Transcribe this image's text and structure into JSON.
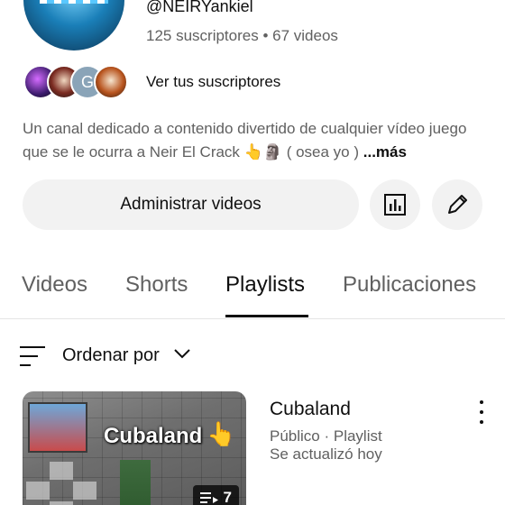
{
  "channel": {
    "handle": "@NEIRYankiel",
    "stats": "125 suscriptores • 67 videos",
    "subscribers_link": "Ver tus suscriptores",
    "subscriber_initial": "G",
    "description": "Un canal dedicado a contenido divertido de cualquier vídeo juego que se le ocurra a Neir El Crack 👆🗿 ( osea yo ) ",
    "more_label": "...más"
  },
  "actions": {
    "manage_label": "Administrar videos",
    "stats_icon": "analytics-icon",
    "edit_icon": "pencil-icon"
  },
  "tabs": [
    {
      "label": "Videos",
      "active": false
    },
    {
      "label": "Shorts",
      "active": false
    },
    {
      "label": "Playlists",
      "active": true
    },
    {
      "label": "Publicaciones",
      "active": false
    }
  ],
  "sort": {
    "label": "Ordenar por",
    "icon": "sort-icon"
  },
  "playlist": {
    "title": "Cubaland",
    "thumbnail_text": "Cubaland",
    "video_count": "7",
    "meta": "Público · Playlist",
    "updated": "Se actualizó hoy"
  },
  "colors": {
    "primary_text": "#0f0f0f",
    "secondary_text": "#606060",
    "button_bg": "#f2f2f2"
  }
}
